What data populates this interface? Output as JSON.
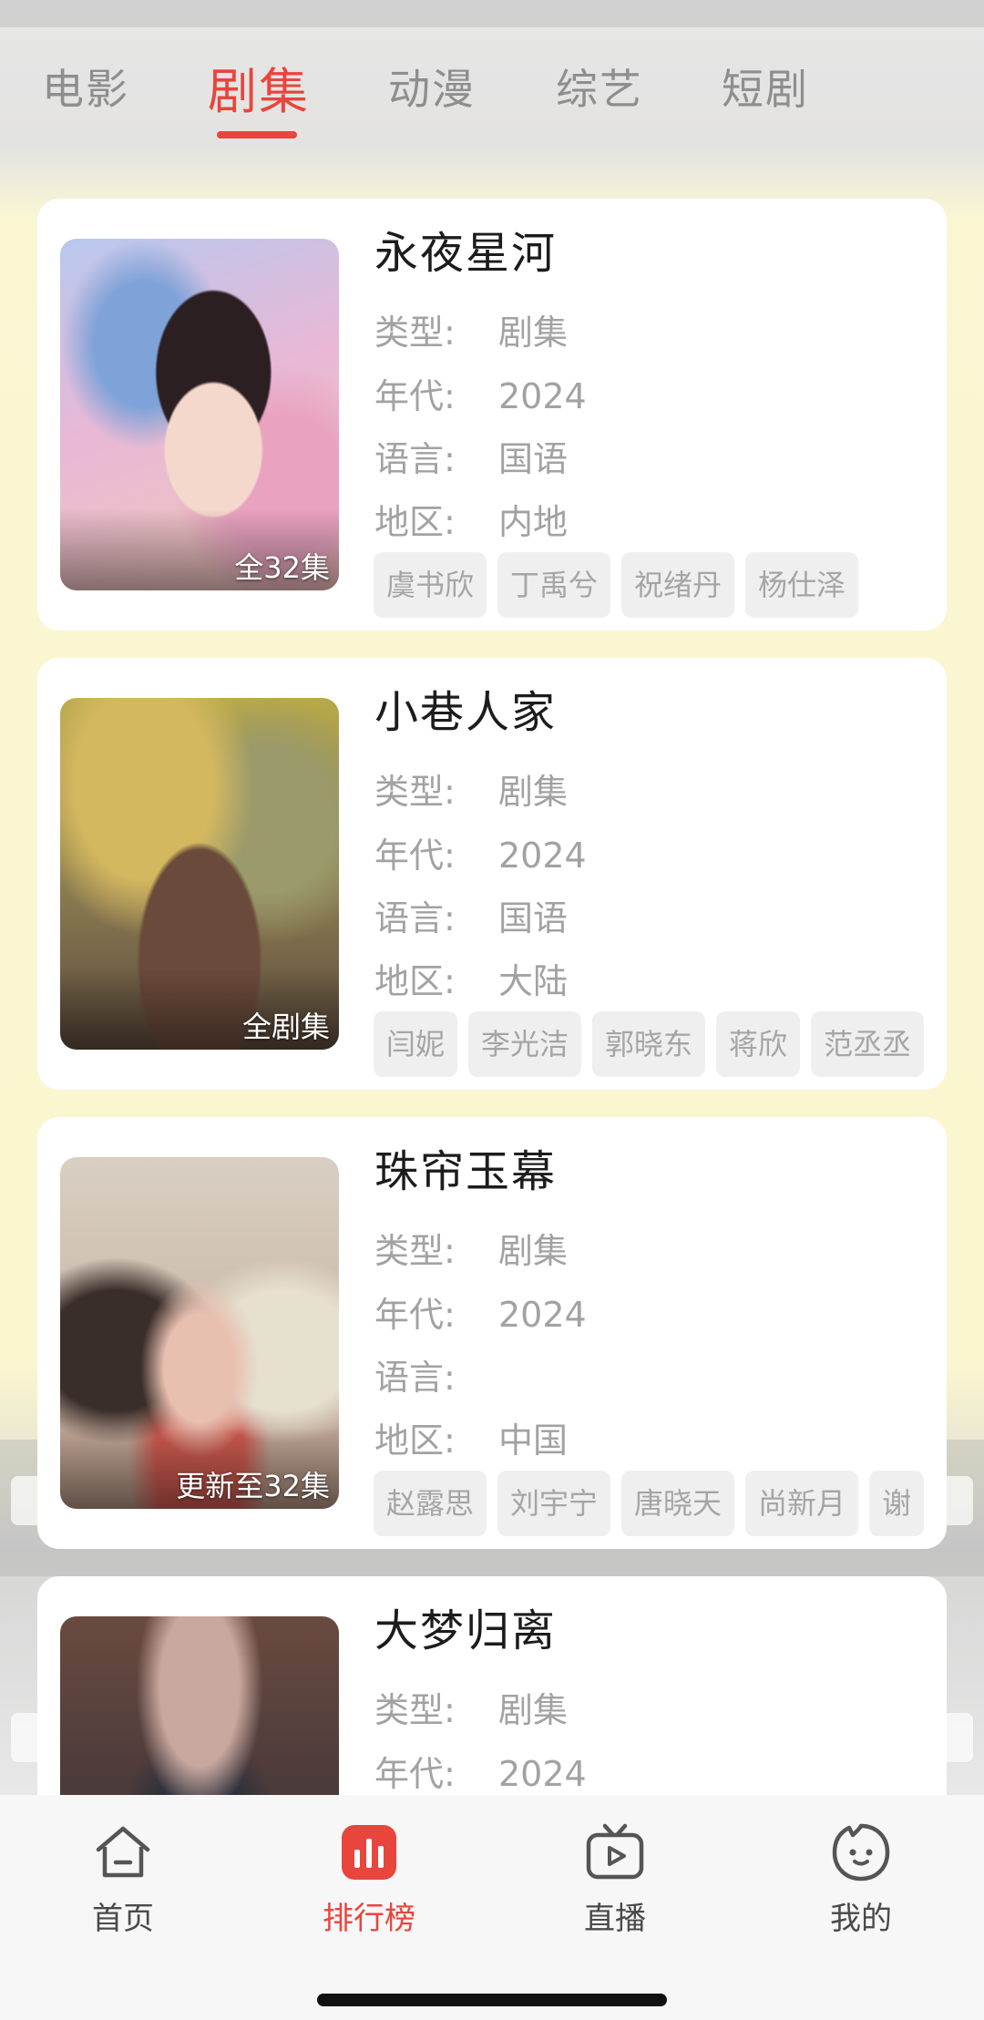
{
  "theme": {
    "accent": "#e8453c",
    "muted": "#a2a2a2"
  },
  "top_tabs": [
    {
      "label": "电影",
      "active": false
    },
    {
      "label": "剧集",
      "active": true
    },
    {
      "label": "动漫",
      "active": false
    },
    {
      "label": "综艺",
      "active": false
    },
    {
      "label": "短剧",
      "active": false
    }
  ],
  "labels": {
    "type": "类型:",
    "year": "年代:",
    "lang": "语言:",
    "region": "地区:"
  },
  "cards": [
    {
      "title": "永夜星河",
      "type": "剧集",
      "year": "2024",
      "lang": "国语",
      "region": "内地",
      "badge": "全32集",
      "cast": [
        "虞书欣",
        "丁禹兮",
        "祝绪丹",
        "杨仕泽"
      ]
    },
    {
      "title": "小巷人家",
      "type": "剧集",
      "year": "2024",
      "lang": "国语",
      "region": "大陆",
      "badge": "全剧集",
      "cast": [
        "闫妮",
        "李光洁",
        "郭晓东",
        "蒋欣",
        "范丞丞"
      ]
    },
    {
      "title": "珠帘玉幕",
      "type": "剧集",
      "year": "2024",
      "lang": "",
      "region": "中国",
      "badge": "更新至32集",
      "cast": [
        "赵露思",
        "刘宇宁",
        "唐晓天",
        "尚新月",
        "谢"
      ]
    },
    {
      "title": "大梦归离",
      "type": "剧集",
      "year": "2024"
    }
  ],
  "bottom_nav": [
    {
      "label": "首页",
      "icon": "home-icon",
      "active": false
    },
    {
      "label": "排行榜",
      "icon": "ranking-icon",
      "active": true
    },
    {
      "label": "直播",
      "icon": "live-tv-icon",
      "active": false
    },
    {
      "label": "我的",
      "icon": "profile-icon",
      "active": false
    }
  ]
}
